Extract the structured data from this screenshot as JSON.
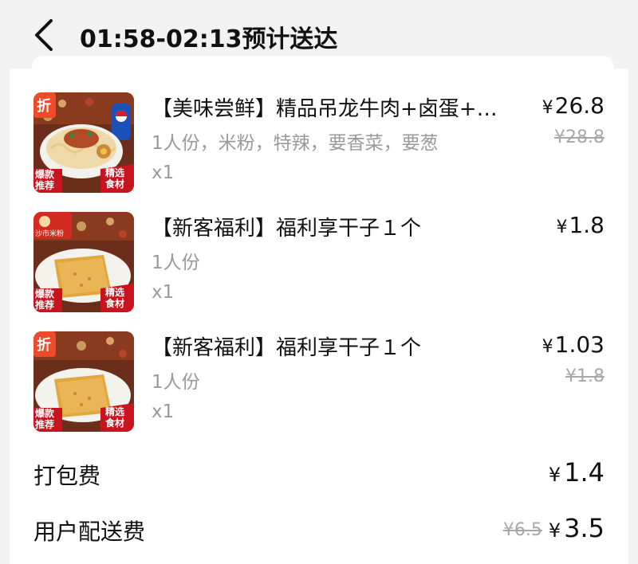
{
  "header": {
    "title": "01:58-02:13预计送达"
  },
  "items": [
    {
      "name": "【美味尝鲜】精品吊龙牛肉+卤蛋+…",
      "spec": "1人份，米粉，特辣，要香菜，要葱",
      "qty": "x1",
      "price": "26.8",
      "original_price": "¥28.8",
      "discount_tag": "折",
      "badge_left": "爆款推荐",
      "badge_right": "精选食材",
      "dish": "noodles"
    },
    {
      "name": "【新客福利】福利享干子１个",
      "spec": "1人份",
      "qty": "x1",
      "price": "1.8",
      "original_price": "",
      "brand_tag": "沙市米粉",
      "badge_left": "爆款推荐",
      "badge_right": "精选食材",
      "dish": "tofu"
    },
    {
      "name": "【新客福利】福利享干子１个",
      "spec": "1人份",
      "qty": "x1",
      "price": "1.03",
      "original_price": "¥1.8",
      "discount_tag": "折",
      "badge_left": "爆款推荐",
      "badge_right": "精选食材",
      "dish": "tofu"
    }
  ],
  "fees": {
    "packing_label": "打包费",
    "packing_value": "1.4",
    "delivery_label": "用户配送费",
    "delivery_original": "¥6.5",
    "delivery_value": "3.5"
  },
  "currency_symbol": "¥",
  "colors": {
    "discount_tag": "#f04a2a",
    "badge_red": "#c8141e",
    "price_text": "#111111",
    "muted_text": "#9a9a9a"
  }
}
